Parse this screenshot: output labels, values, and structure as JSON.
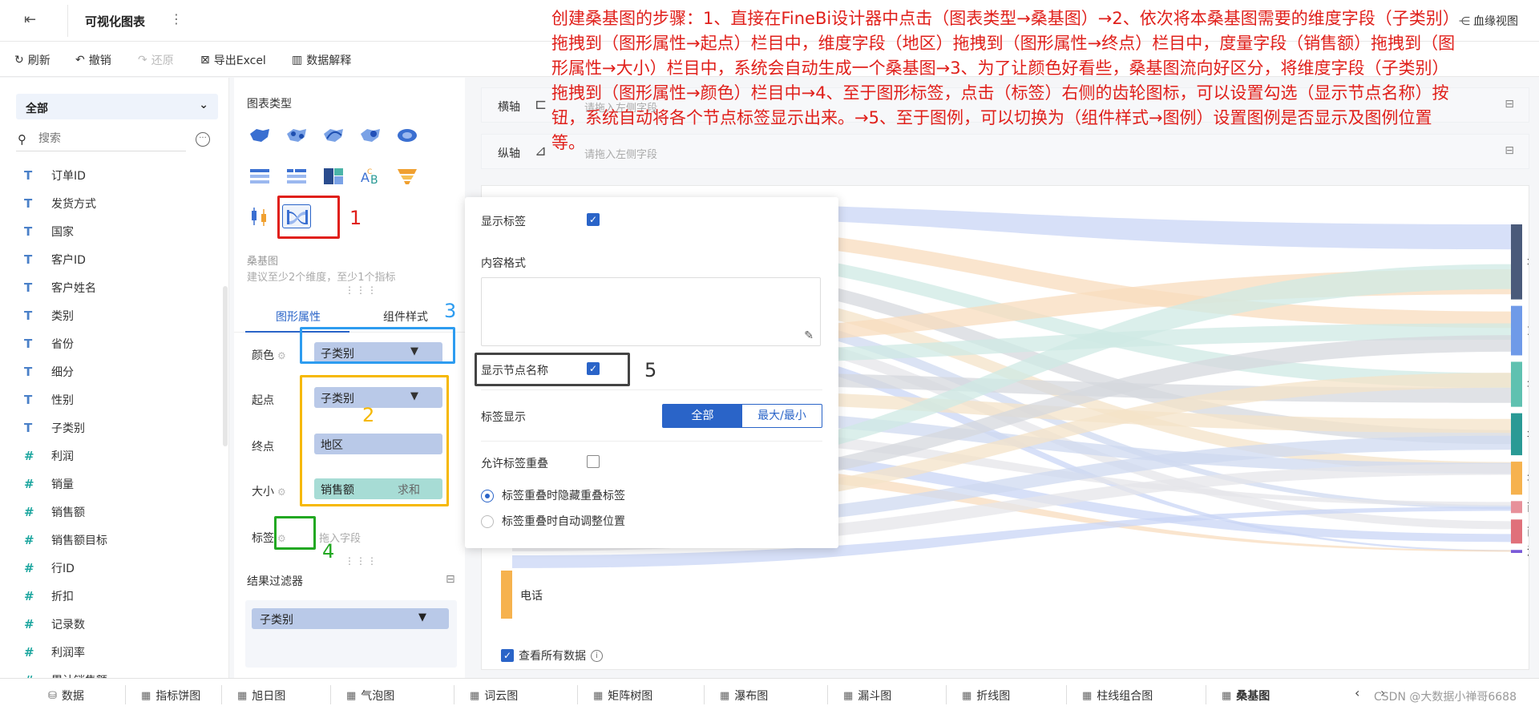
{
  "topbar": {
    "title": "可视化图表",
    "more_glyph": "⋮",
    "bloodline": "血缘视图"
  },
  "toolbar": {
    "refresh": "刷新",
    "undo": "撤销",
    "redo": "还原",
    "export": "导出Excel",
    "explain": "数据解释"
  },
  "fields_panel": {
    "dataset": "全部",
    "search_placeholder": "搜索",
    "fields": [
      {
        "type": "T",
        "name": "订单ID"
      },
      {
        "type": "T",
        "name": "发货方式"
      },
      {
        "type": "T",
        "name": "国家"
      },
      {
        "type": "T",
        "name": "客户ID"
      },
      {
        "type": "T",
        "name": "客户姓名"
      },
      {
        "type": "T",
        "name": "类别"
      },
      {
        "type": "T",
        "name": "省份"
      },
      {
        "type": "T",
        "name": "细分"
      },
      {
        "type": "T",
        "name": "性别"
      },
      {
        "type": "T",
        "name": "子类别"
      },
      {
        "type": "#",
        "name": "利润"
      },
      {
        "type": "#",
        "name": "销量"
      },
      {
        "type": "#",
        "name": "销售额"
      },
      {
        "type": "#",
        "name": "销售额目标"
      },
      {
        "type": "#",
        "name": "行ID"
      },
      {
        "type": "#",
        "name": "折扣"
      },
      {
        "type": "#",
        "name": "记录数"
      },
      {
        "type": "#",
        "name": "利润率"
      },
      {
        "type": "#",
        "name": "累计销售额"
      }
    ]
  },
  "chart_type_panel": {
    "header": "图表类型",
    "selected_name": "桑基图",
    "selected_hint": "建议至少2个维度，至少1个指标",
    "tabs": [
      "图形属性",
      "组件样式"
    ],
    "rows": {
      "color": {
        "label": "颜色",
        "field": "子类别"
      },
      "start": {
        "label": "起点",
        "field": "子类别"
      },
      "end": {
        "label": "终点",
        "field": "地区"
      },
      "size": {
        "label": "大小",
        "field": "销售额",
        "agg": "求和"
      },
      "label": {
        "label": "标签",
        "hint": "拖入字段"
      }
    },
    "filter_header": "结果过滤器",
    "filter_field": "子类别"
  },
  "canvas": {
    "x_axis_label": "横轴",
    "y_axis_label": "纵轴",
    "x_axis_hint": "请拖入左侧字段",
    "y_axis_hint": "请拖入左侧字段",
    "view_all": "查看所有数据"
  },
  "sankey": {
    "source_label": "电话",
    "targets": [
      "华东",
      "东北",
      "华中",
      "华北",
      "华南",
      "西北",
      "西南",
      "港澳台"
    ],
    "target_colors": [
      "#4a5a7a",
      "#6f9ae8",
      "#5fc1b0",
      "#2a9a95",
      "#f6b24e",
      "#e7909a",
      "#e0707a",
      "#7a5ad8"
    ],
    "target_values": [
      0.25,
      0.165,
      0.15,
      0.14,
      0.11,
      0.04,
      0.08,
      0.01
    ]
  },
  "popover": {
    "show_label": "显示标签",
    "content_format": "内容格式",
    "show_node_name": "显示节点名称",
    "label_display": "标签显示",
    "seg_all": "全部",
    "seg_maxmin": "最大/最小",
    "allow_overlap": "允许标签重叠",
    "radio_hide": "标签重叠时隐藏重叠标签",
    "radio_adjust": "标签重叠时自动调整位置"
  },
  "annotations": {
    "n1": "1",
    "n2": "2",
    "n3": "3",
    "n4": "4",
    "n5": "5",
    "instructions": "创建桑基图的步骤：1、直接在FineBi设计器中点击（图表类型→桑基图）→2、依次将本桑基图需要的维度字段（子类别）拖拽到（图形属性→起点）栏目中，维度字段（地区）拖拽到（图形属性→终点）栏目中，度量字段（销售额）拖拽到（图形属性→大小）栏目中，系统会自动生成一个桑基图→3、为了让颜色好看些，桑基图流向好区分，将维度字段（子类别）拖拽到（图形属性→颜色）栏目中→4、至于图形标签，点击（标签）右侧的齿轮图标，可以设置勾选（显示节点名称）按钮，系统自动将各个节点标签显示出来。→5、至于图例，可以切换为（组件样式→图例）设置图例是否显示及图例位置等。"
  },
  "bottom_tabs": [
    "数据",
    "指标饼图",
    "旭日图",
    "气泡图",
    "词云图",
    "矩阵树图",
    "瀑布图",
    "漏斗图",
    "折线图",
    "柱线组合图",
    "桑基图"
  ],
  "watermark": "CSDN @大数据小禅哥6688"
}
